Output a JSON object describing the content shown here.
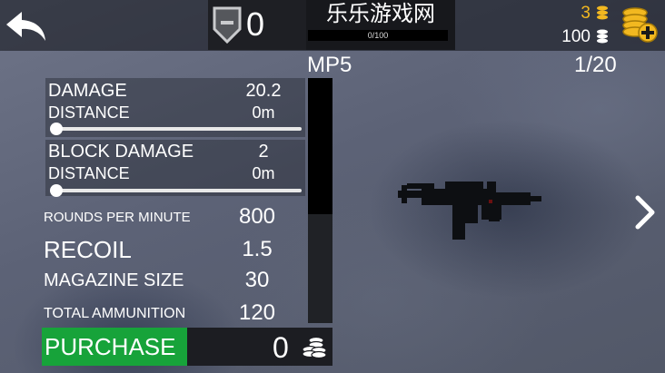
{
  "header": {
    "back_icon": "back-arrow-icon",
    "rank_icon": "rank-shield-icon",
    "rank_value": "0",
    "game_title": "乐乐游戏网",
    "xp_text": "0/100",
    "gold_amount": "3",
    "coin_amount": "100",
    "add_icon": "add-coins-icon"
  },
  "weapon": {
    "name": "MP5",
    "page": "1/20",
    "stats": {
      "damage_label": "DAMAGE",
      "damage_value": "20.2",
      "damage_distance_label": "DISTANCE",
      "damage_distance_value": "0m",
      "block_damage_label": "BLOCK DAMAGE",
      "block_damage_value": "2",
      "block_distance_label": "DISTANCE",
      "block_distance_value": "0m",
      "rpm_label": "ROUNDS PER MINUTE",
      "rpm_value": "800",
      "recoil_label": "RECOIL",
      "recoil_value": "1.5",
      "magazine_label": "MAGAZINE SIZE",
      "magazine_value": "30",
      "ammo_label": "TOTAL AMMUNITION",
      "ammo_value": "120"
    },
    "damage_distance_slider": 0,
    "block_distance_slider": 0
  },
  "purchase": {
    "label": "PURCHASE",
    "price": "0",
    "price_icon": "coins-stack-icon"
  },
  "nav": {
    "next_icon": "chevron-right-icon"
  },
  "colors": {
    "gold": "#f2b820",
    "purchase": "#17a33a"
  }
}
